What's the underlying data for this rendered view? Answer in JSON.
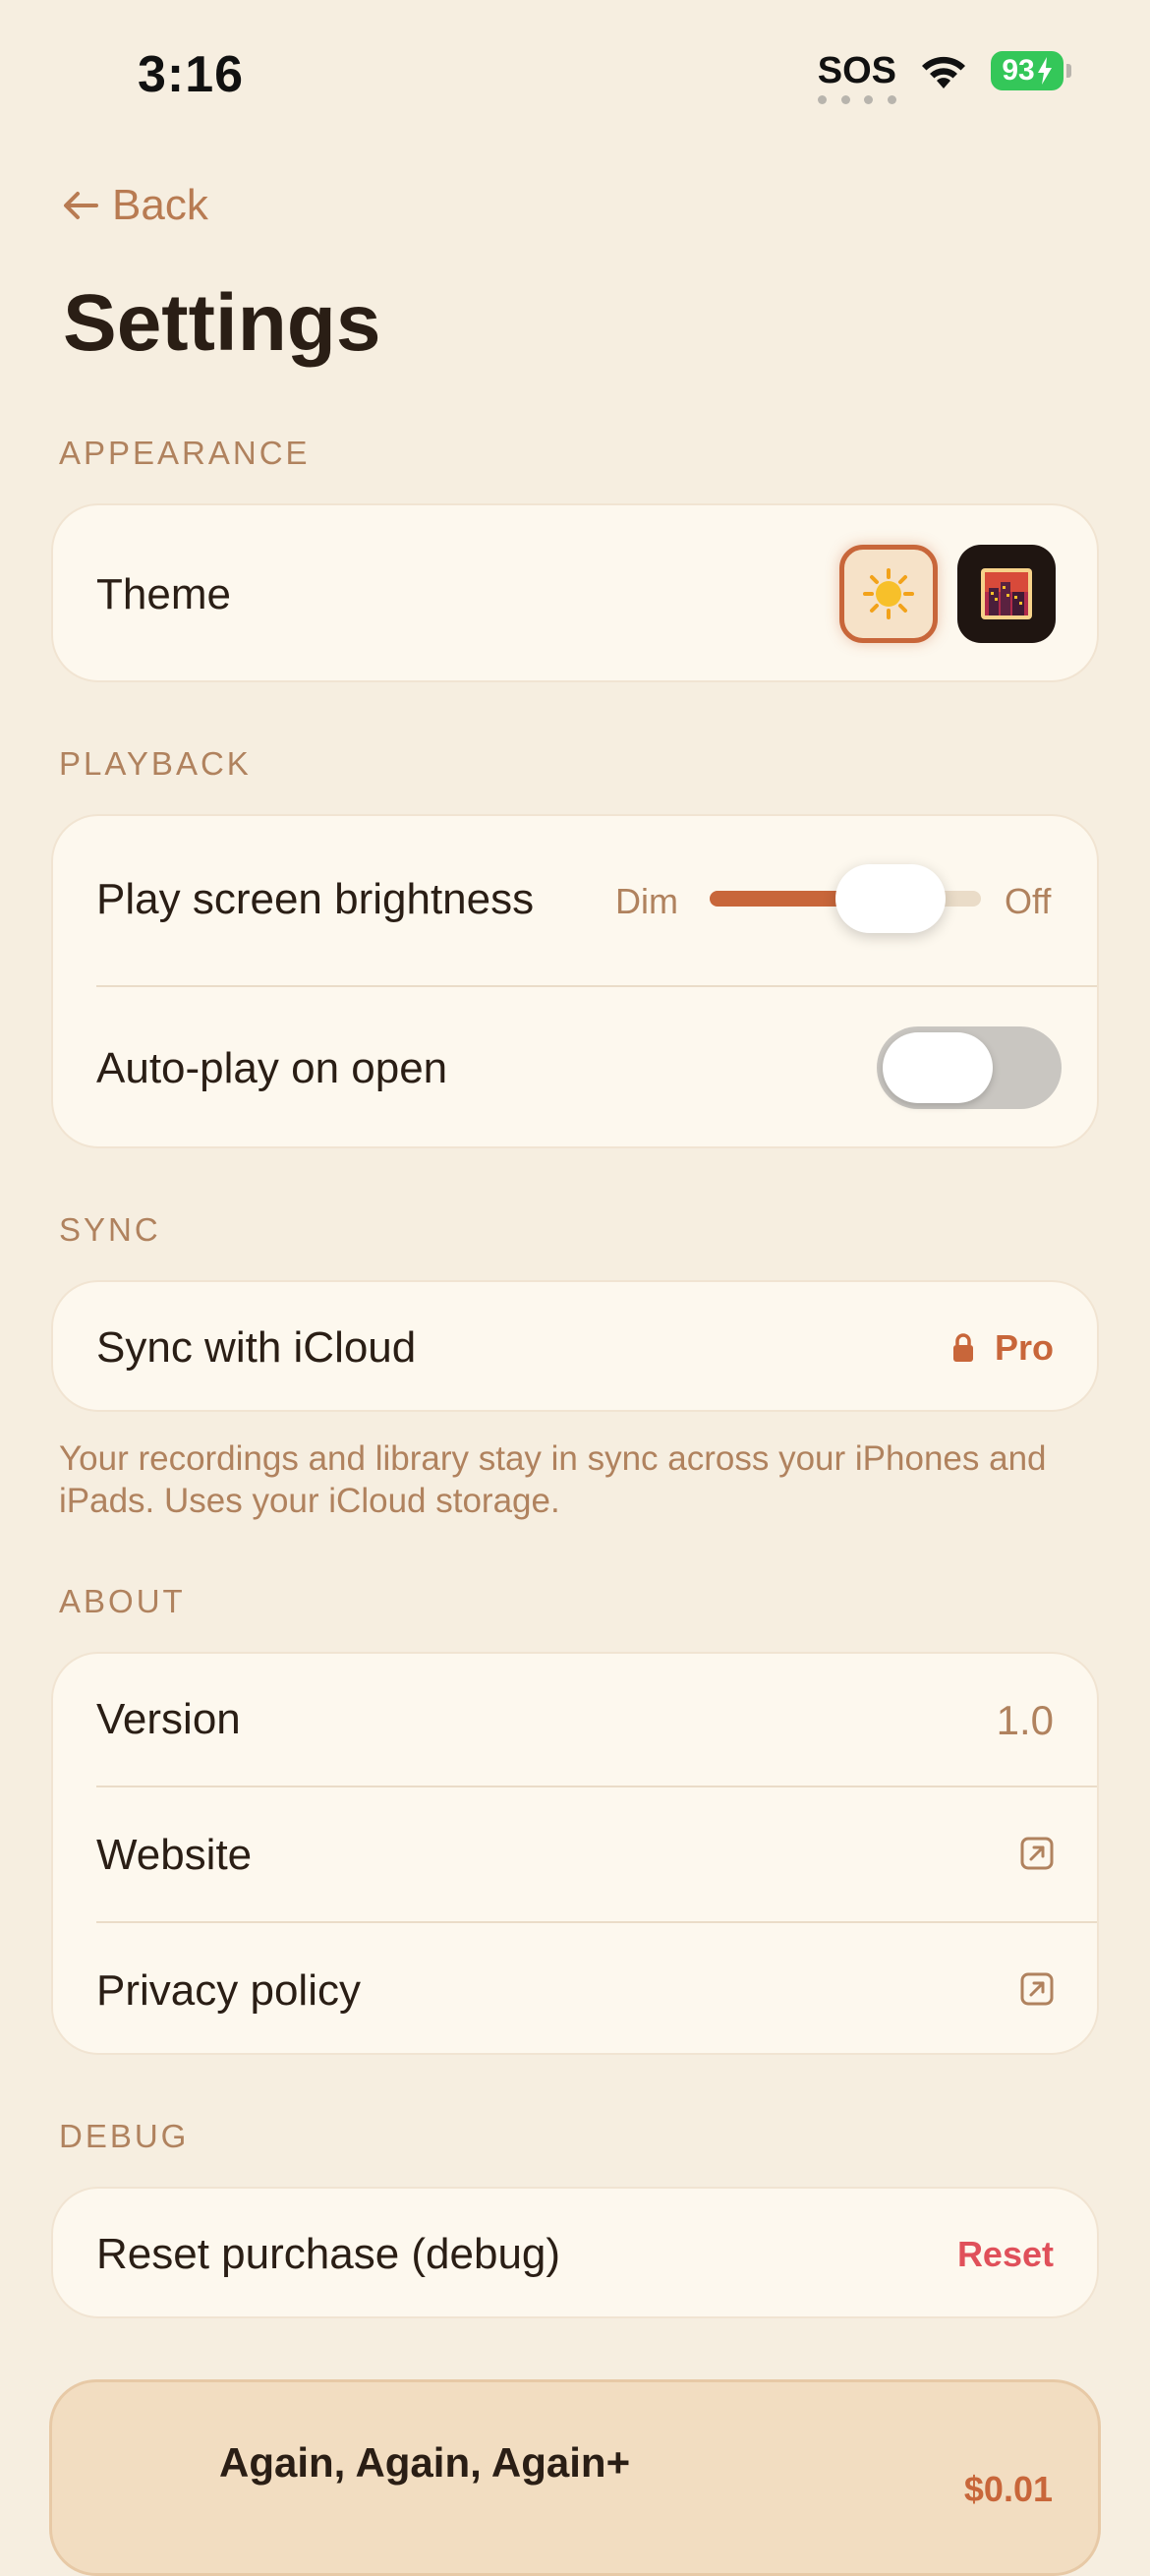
{
  "status_bar": {
    "time": "3:16",
    "sos": "SOS",
    "battery": "93"
  },
  "header": {
    "back_label": "Back",
    "title": "Settings"
  },
  "sections": {
    "appearance": {
      "label": "APPEARANCE",
      "theme_label": "Theme",
      "themes": [
        "light-sun",
        "dark-city"
      ],
      "selected_theme": "light-sun"
    },
    "playback": {
      "label": "PLAYBACK",
      "brightness_label": "Play screen brightness",
      "brightness_min": "Dim",
      "brightness_max": "Off",
      "brightness_value": 0.78,
      "autoplay_label": "Auto-play on open",
      "autoplay_on": false
    },
    "sync": {
      "label": "SYNC",
      "icloud_label": "Sync with iCloud",
      "pro_badge": "Pro",
      "footnote": "Your recordings and library stay in sync across your iPhones and iPads. Uses your iCloud storage."
    },
    "about": {
      "label": "ABOUT",
      "version_label": "Version",
      "version_value": "1.0",
      "website_label": "Website",
      "privacy_label": "Privacy policy"
    },
    "debug": {
      "label": "DEBUG",
      "reset_label": "Reset purchase (debug)",
      "reset_button": "Reset"
    }
  },
  "promo": {
    "title": "Again, Again, Again+",
    "price": "$0.01"
  },
  "colors": {
    "accent": "#C8663A",
    "background": "#F6EEE0",
    "danger": "#E0505A",
    "toggle_off": "#C9C6C1"
  }
}
